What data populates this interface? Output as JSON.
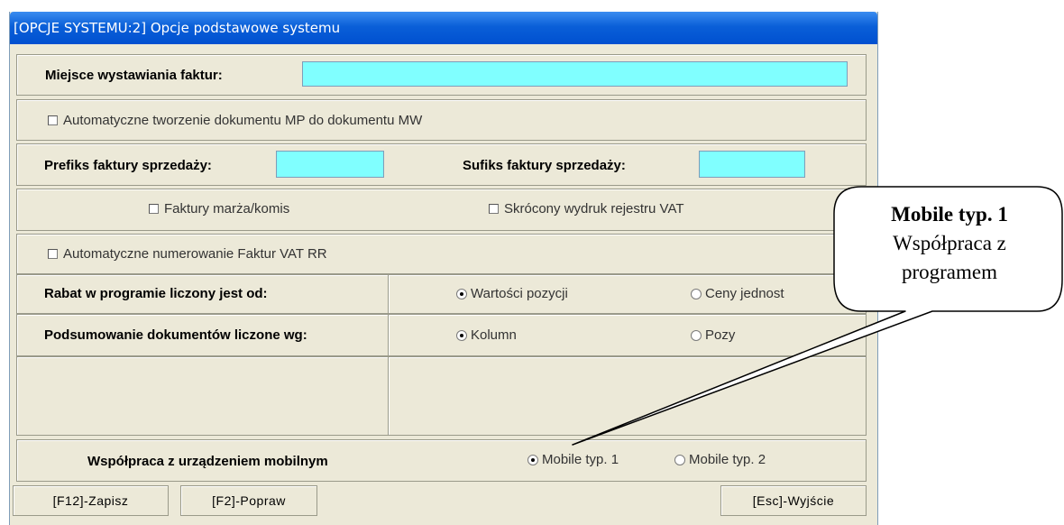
{
  "window": {
    "title": "[OPCJE SYSTEMU:2]  Opcje podstawowe systemu"
  },
  "invoice_place": {
    "label": "Miejsce wystawiania faktur:",
    "value": ""
  },
  "auto_mp": {
    "label": "Automatyczne tworzenie dokumentu MP do dokumentu MW",
    "checked": false
  },
  "prefix": {
    "label": "Prefiks faktury sprzedaży:",
    "value": ""
  },
  "suffix": {
    "label": "Sufiks faktury sprzedaży:",
    "value": ""
  },
  "margin_invoices": {
    "label": "Faktury marża/komis",
    "checked": false
  },
  "short_vat": {
    "label": "Skrócony wydruk rejestru VAT",
    "checked": false
  },
  "auto_rr": {
    "label": "Automatyczne numerowanie Faktur VAT RR",
    "checked": false
  },
  "discount": {
    "label": "Rabat w programie liczony jest od:",
    "options": [
      "Wartości pozycji",
      "Ceny jednost"
    ],
    "selected": "Wartości pozycji"
  },
  "summary": {
    "label": "Podsumowanie dokumentów liczone wg:",
    "options": [
      "Kolumn",
      "Pozy"
    ],
    "selected": "Kolumn"
  },
  "mobile": {
    "label": "Współpraca z urządzeniem mobilnym",
    "options": [
      "Mobile typ. 1",
      "Mobile typ. 2"
    ],
    "selected": "Mobile typ. 1"
  },
  "buttons": {
    "save": "[F12]-Zapisz",
    "edit": "[F2]-Popraw",
    "exit": "[Esc]-Wyjście"
  },
  "callout": {
    "title": "Mobile typ. 1",
    "line1": "Współpraca z",
    "line2": "programem"
  }
}
